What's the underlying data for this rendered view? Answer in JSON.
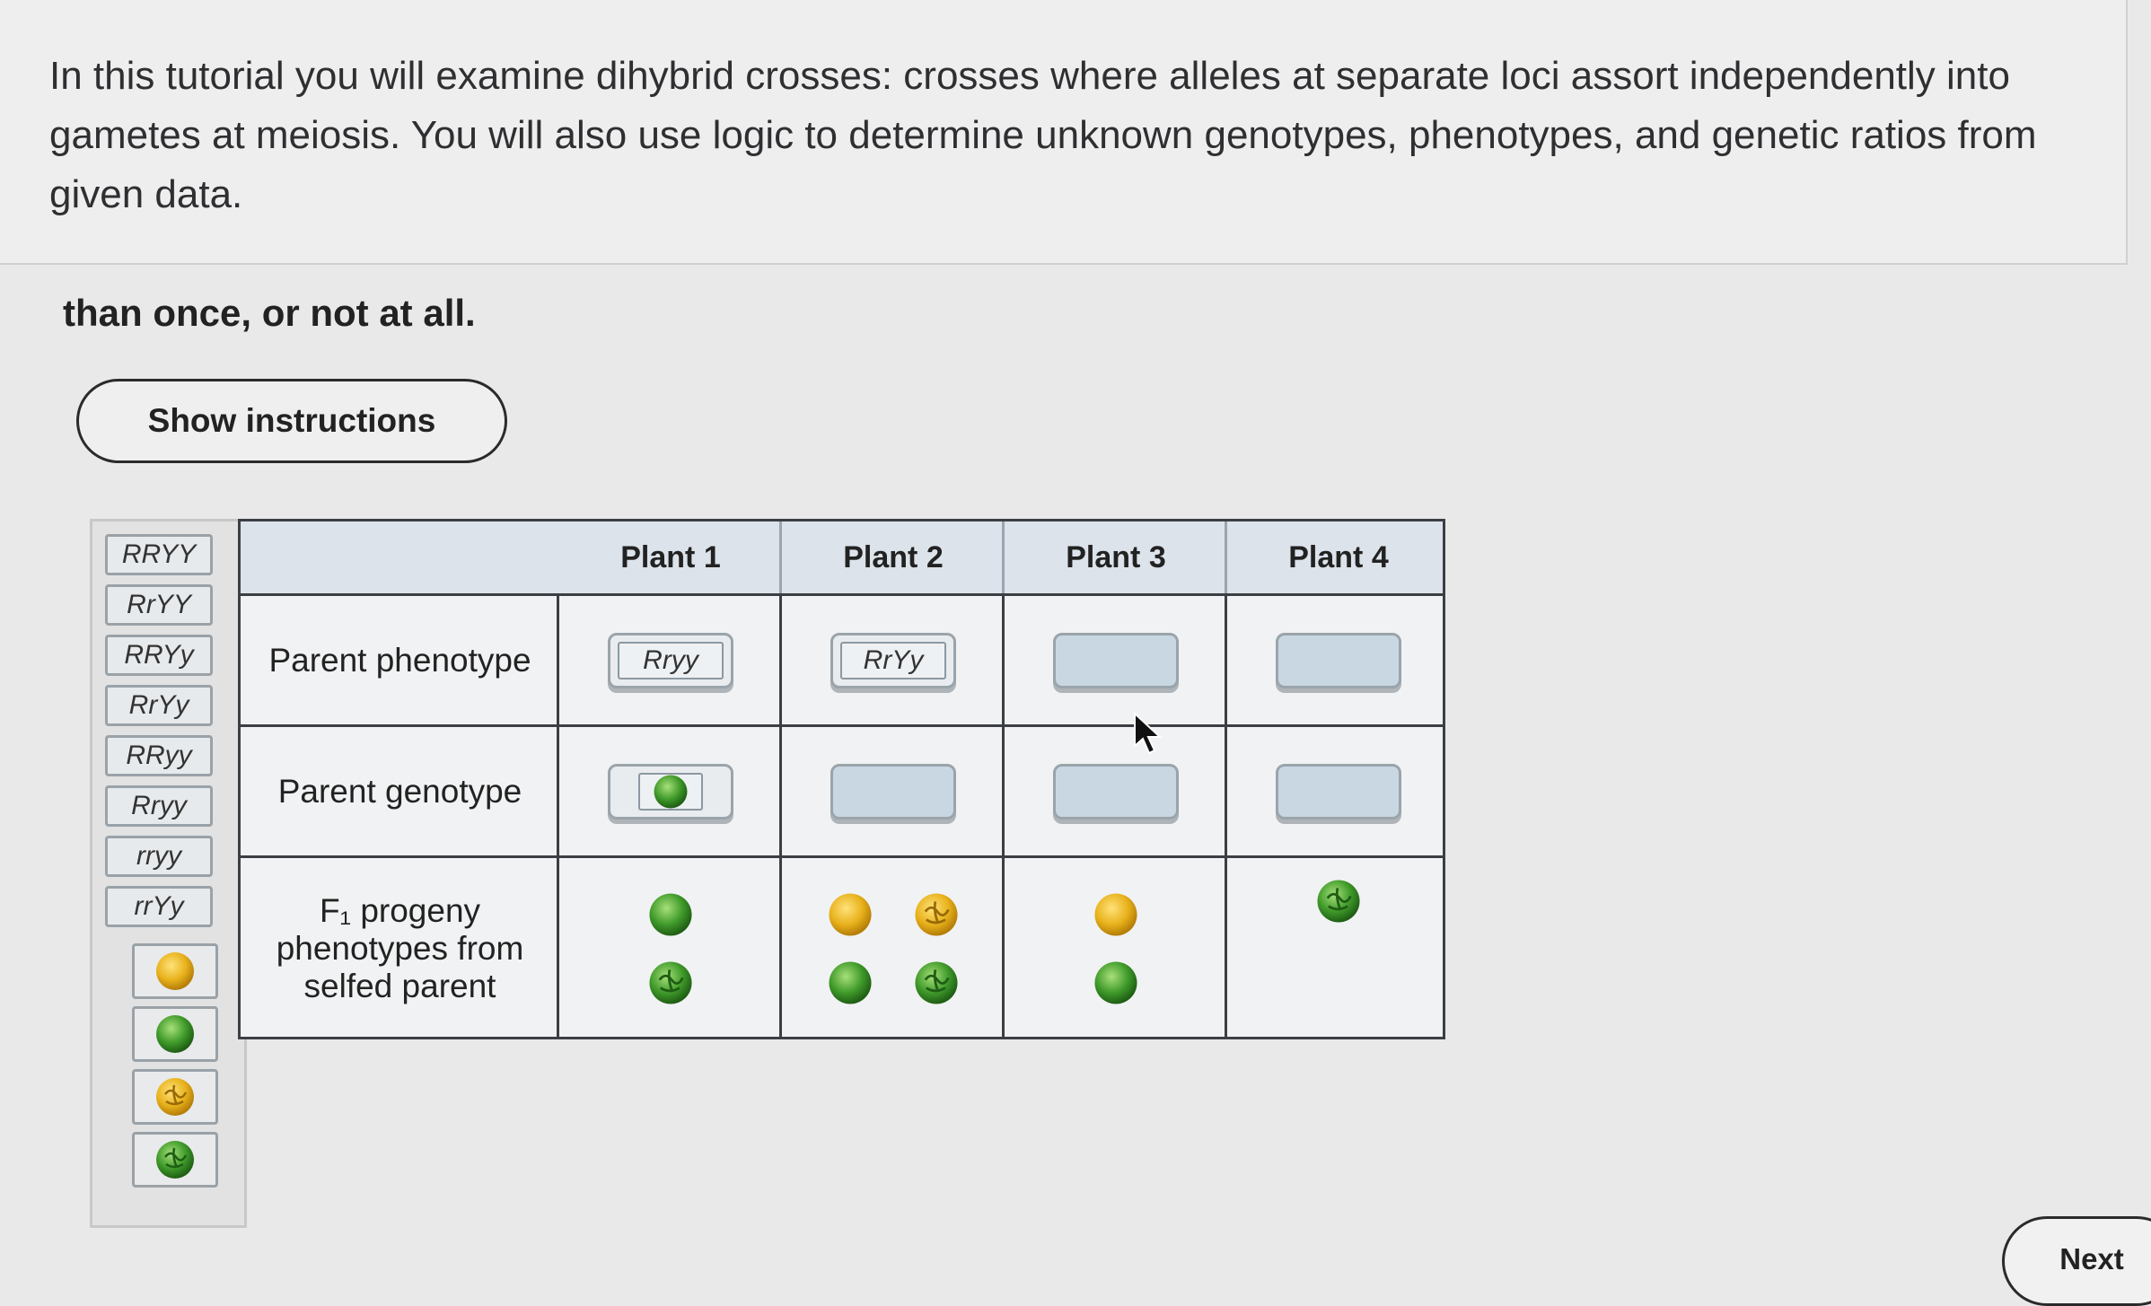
{
  "intro": {
    "text": "In this tutorial you will examine dihybrid crosses: crosses where alleles at separate loci assort independently into gametes at meiosis. You will also use logic to determine unknown genotypes, phenotypes, and genetic ratios from given data."
  },
  "lead_text": "than once, or not at all.",
  "show_instructions_label": "Show instructions",
  "palette": {
    "labels": [
      "RRYY",
      "RrYY",
      "RRYy",
      "RrYy",
      "RRyy",
      "Rryy",
      "rryy",
      "rrYy"
    ],
    "peas": [
      "yellow-round-pea-icon",
      "green-round-pea-icon",
      "yellow-wrinkled-pea-icon",
      "green-wrinkled-pea-icon"
    ]
  },
  "table": {
    "columns": [
      "Plant 1",
      "Plant 2",
      "Plant 3",
      "Plant 4"
    ],
    "rows": {
      "phenotype": "Parent phenotype",
      "genotype": "Parent genotype",
      "progeny": "F₁ progeny phenotypes from selfed parent"
    },
    "phenotype_slots": [
      "Rryy",
      "RrYy",
      "",
      ""
    ],
    "genotype_slots": [
      "green-round-pea-icon",
      "",
      "",
      ""
    ],
    "progeny": [
      [
        "green-round-pea-icon",
        "green-wrinkled-pea-icon"
      ],
      [
        "yellow-round-pea-icon",
        "yellow-wrinkled-pea-icon",
        "green-round-pea-icon",
        "green-wrinkled-pea-icon"
      ],
      [
        "yellow-round-pea-icon",
        "green-round-pea-icon"
      ],
      [
        "green-wrinkled-pea-icon"
      ]
    ]
  },
  "colors": {
    "yellow_pea": "#e8b21c",
    "green_pea": "#3f9a2a",
    "drop_slot": "#c8d7e2",
    "header_band": "#dce3ea"
  },
  "next_label": "Next"
}
